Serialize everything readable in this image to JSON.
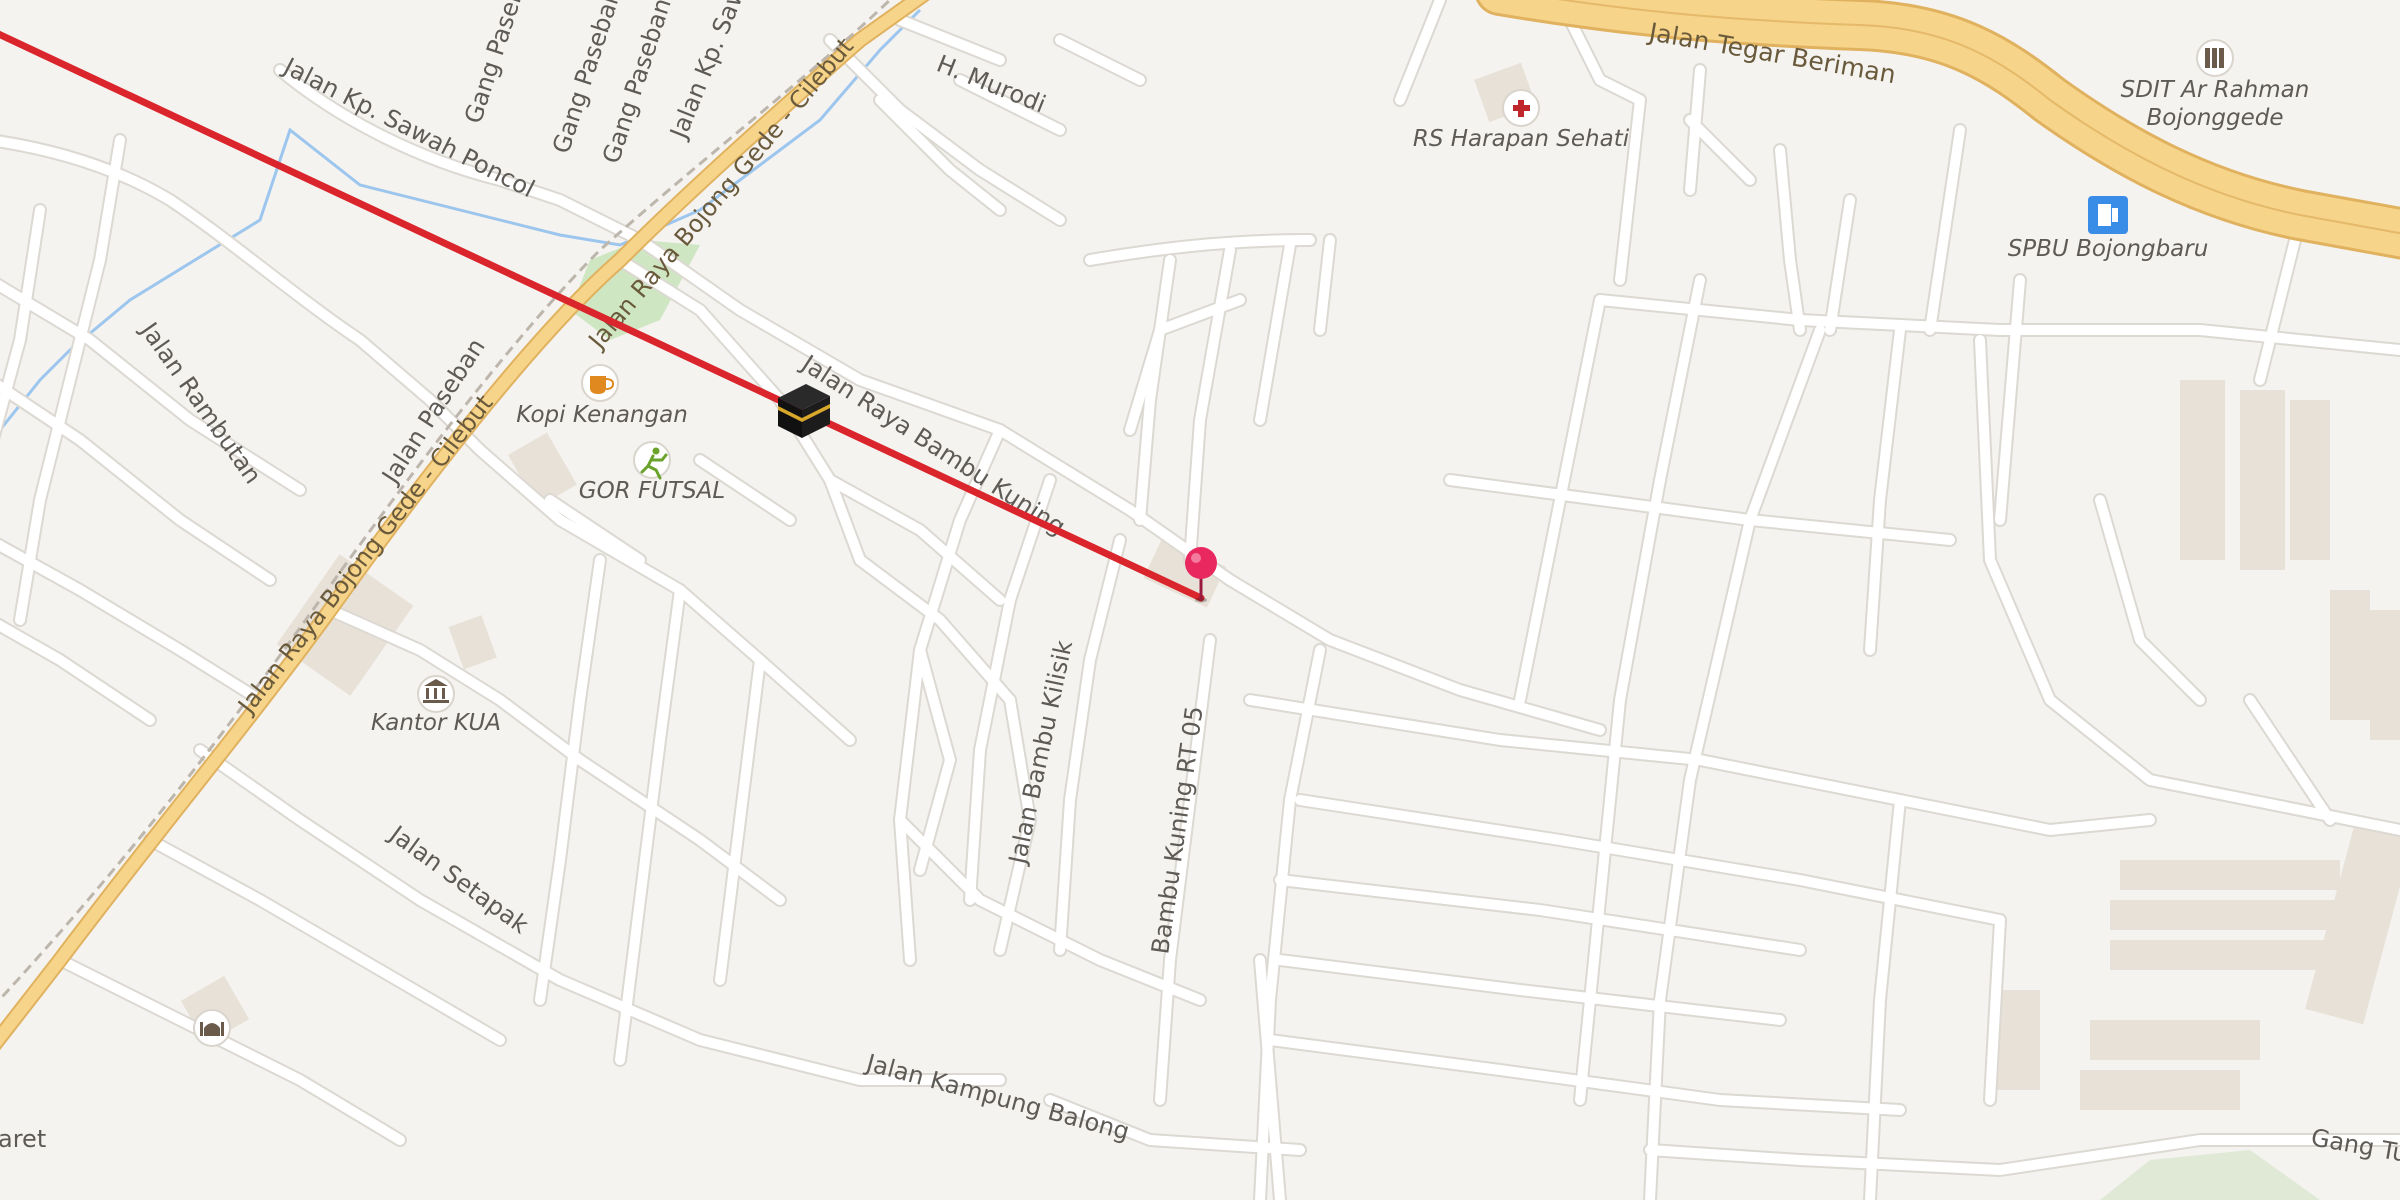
{
  "map": {
    "colors": {
      "land": "#f5f3f0",
      "road": "#ffffff",
      "road_casing": "#dcd8d2",
      "highway": "#f6d48a",
      "highway_casing": "#e0b25f",
      "water": "#9cc6ee",
      "park": "#cfe6c2",
      "building": "#e8e1d8",
      "route_line": "#d9252b",
      "pin": "#e8285f"
    },
    "streets": [
      {
        "id": "tegar",
        "name": "Jalan Tegar Beriman"
      },
      {
        "id": "bojong1",
        "name": "Jalan Raya Bojong Gede - Cilebut"
      },
      {
        "id": "bojong2",
        "name": "Jalan Raya Bojong Gede - Cilebut"
      },
      {
        "id": "bambukuning",
        "name": "Jalan Raya Bambu Kuning"
      },
      {
        "id": "sawahponcol",
        "name": "Jalan Kp. Sawah Poncol"
      },
      {
        "id": "paseban",
        "name": "Jalan Paseban"
      },
      {
        "id": "rambutan",
        "name": "Jalan Rambutan"
      },
      {
        "id": "setapak",
        "name": "Jalan Setapak"
      },
      {
        "id": "kampungbalong",
        "name": "Jalan Kampung Balong"
      },
      {
        "id": "bambukilisik",
        "name": "Jalan Bambu Kilisik"
      },
      {
        "id": "bambukuningrt",
        "name": "Bambu Kuning RT 05"
      },
      {
        "id": "murodi",
        "name": "H. Murodi"
      },
      {
        "id": "gangpaseban1",
        "name": "Gang Paseban"
      },
      {
        "id": "gangpaseban2",
        "name": "Gang Paseban"
      },
      {
        "id": "gangpaseban3",
        "name": "Gang Paseban -"
      },
      {
        "id": "kpsawa",
        "name": "Jalan Kp. Sawa"
      },
      {
        "id": "gangtu",
        "name": "Gang Tu"
      },
      {
        "id": "aret",
        "name": "aret"
      }
    ],
    "pois": [
      {
        "id": "rs",
        "name": "RS Harapan Sehati",
        "icon": "hospital-icon"
      },
      {
        "id": "sdit",
        "name": "SDIT Ar Rahman Bojonggede",
        "icon": "school-icon"
      },
      {
        "id": "spbu",
        "name": "SPBU Bojongbaru",
        "icon": "fuel-icon"
      },
      {
        "id": "kopi",
        "name": "Kopi Kenangan",
        "icon": "cafe-icon"
      },
      {
        "id": "gor",
        "name": "GOR FUTSAL",
        "icon": "sports-icon"
      },
      {
        "id": "kua",
        "name": "Kantor KUA",
        "icon": "government-icon"
      },
      {
        "id": "mosque",
        "name": "",
        "icon": "mosque-icon"
      }
    ],
    "markers": [
      {
        "id": "kaaba",
        "icon": "kaaba-icon"
      },
      {
        "id": "pin",
        "icon": "location-pin-icon"
      }
    ],
    "overlay": {
      "type": "qibla-direction-line"
    }
  }
}
